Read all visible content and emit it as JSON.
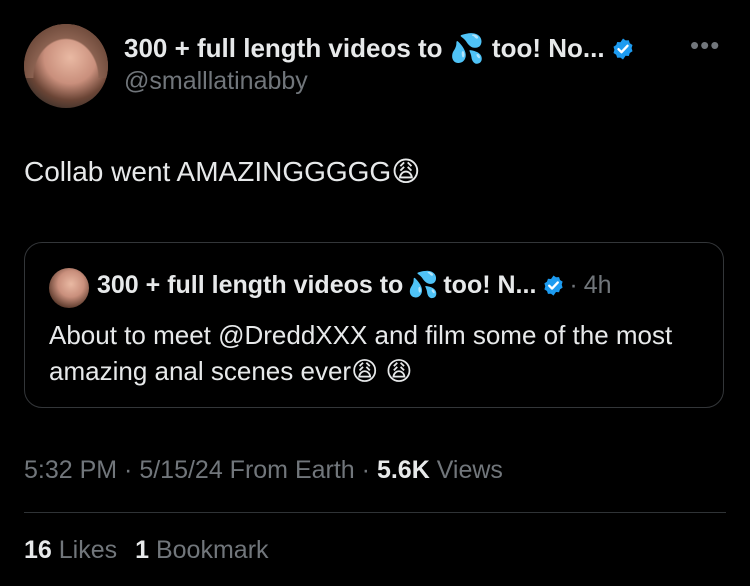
{
  "tweet": {
    "display_name_prefix": "300 + full length videos to",
    "display_name_emoji": "💦",
    "display_name_suffix": "too! No...",
    "handle": "@smalllatinabby",
    "more_icon": "•••",
    "text": "Collab went AMAZINGGGGG",
    "text_emoji": "😩"
  },
  "quote": {
    "display_name_prefix": "300 + full length videos to",
    "display_name_emoji": "💦",
    "display_name_suffix": "too! N...",
    "separator": "·",
    "time": "4h",
    "text": "About to meet @DreddXXX and film some of the most amazing anal scenes ever",
    "text_emojis": "😩 😩"
  },
  "meta": {
    "time": "5:32 PM",
    "sep1": " · ",
    "date": "5/15/24 From Earth",
    "sep2": " · ",
    "views_count": "5.6K",
    "views_label": " Views"
  },
  "stats": {
    "likes_count": "16",
    "likes_label": " Likes",
    "bookmarks_count": "1",
    "bookmarks_label": " Bookmark"
  },
  "colors": {
    "background": "#000000",
    "primary_text": "#e7e9ea",
    "secondary_text": "#71767b",
    "verified": "#1d9bf0",
    "border": "#333639"
  }
}
